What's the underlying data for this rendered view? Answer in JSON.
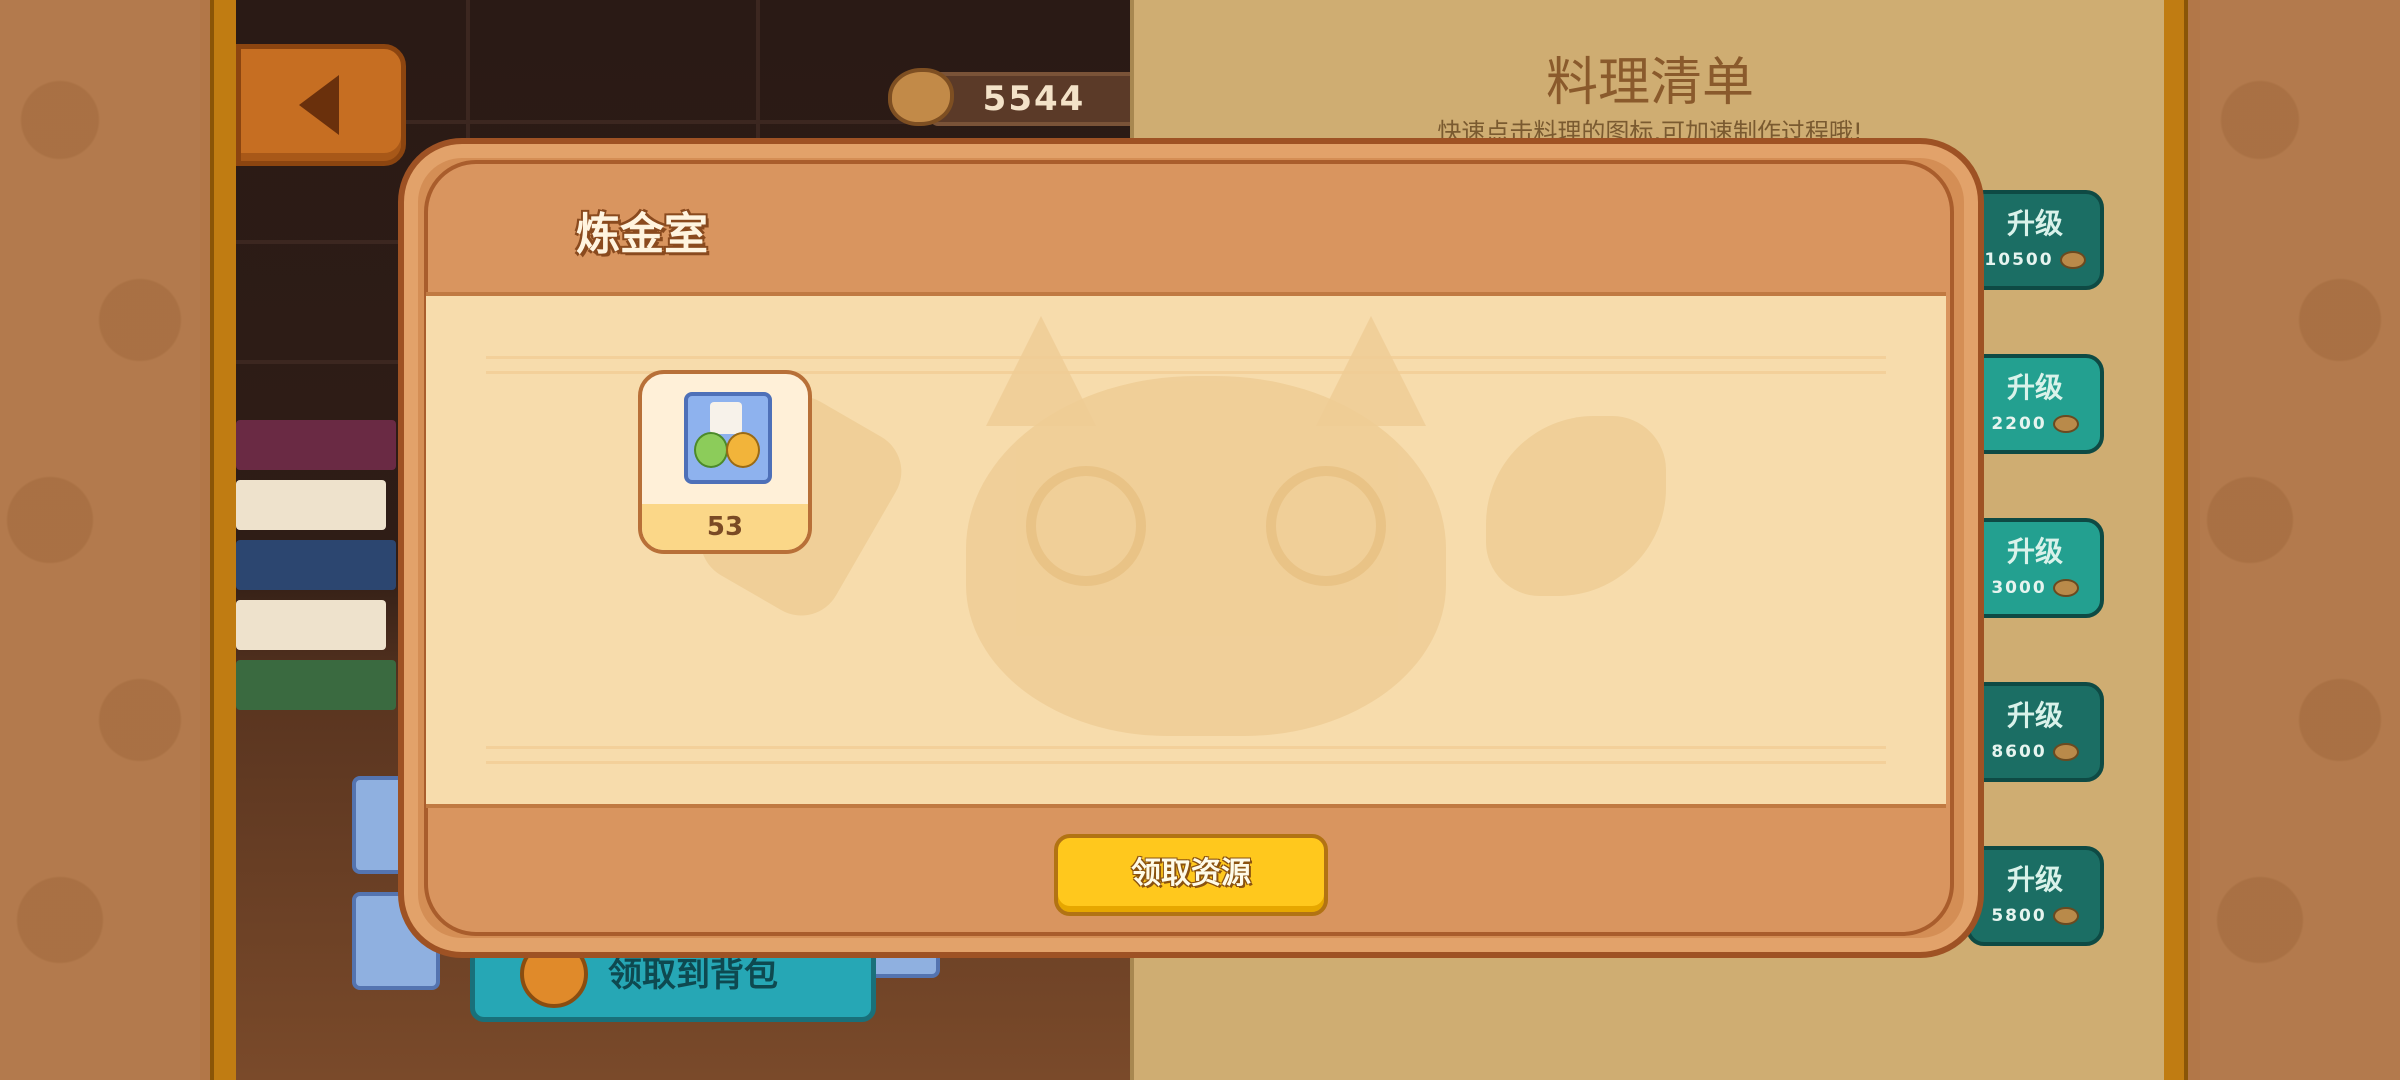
{
  "hud": {
    "coins": "5544"
  },
  "recipe_panel": {
    "title": "料理清单",
    "subtitle": "快速点击料理的图标,可加速制作过程哦!",
    "upgrades": [
      {
        "label": "升级",
        "cost": "10500"
      },
      {
        "label": "升级",
        "cost": "2200"
      },
      {
        "label": "升级",
        "cost": "3000"
      },
      {
        "label": "升级",
        "cost": "8600"
      },
      {
        "label": "升级",
        "cost": "5800"
      }
    ]
  },
  "background_scene": {
    "bag_button_label": "领取到背包"
  },
  "modal": {
    "title": "炼金室",
    "item": {
      "icon": "alchemy-box-icon",
      "count": "53"
    },
    "claim_button_label": "领取资源"
  },
  "colors": {
    "modal_frame": "#d48e55",
    "modal_content": "#f7dcac",
    "claim_button": "#ffc81d",
    "upgrade_button": "#1f8a80"
  }
}
